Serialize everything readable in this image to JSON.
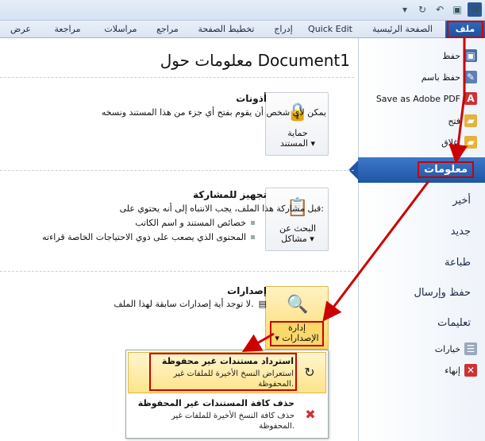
{
  "qat": {
    "word": "W"
  },
  "tabs": {
    "file": "ملف",
    "home": "الصفحة الرئيسية",
    "quickedit": "Quick Edit",
    "insert": "إدراج",
    "pagelayout": "تخطيط الصفحة",
    "references": "مراجع",
    "mailings": "مراسلات",
    "review": "مراجعة",
    "view": "عرض"
  },
  "left": {
    "save": "حفظ",
    "saveas": "حفظ باسم",
    "saveaspdf": "Save as Adobe PDF",
    "open": "فتح",
    "close": "إغلاق",
    "info": "معلومات",
    "recent": "أخير",
    "new": "جديد",
    "print": "طباعة",
    "savesend": "حفظ وإرسال",
    "help": "تعليمات",
    "options": "خيارات",
    "exit": "إنهاء"
  },
  "main": {
    "title": "معلومات حول Document1",
    "permissions": {
      "title": "أذونات",
      "desc": "يمكن لأي شخص أن يقوم بفتح أي جزء من هذا المستند ونسخه",
      "btn1": "حماية",
      "btn2": "المستند"
    },
    "share": {
      "title": "تجهيز للمشاركة",
      "desc": "قبل مشاركة هذا الملف، يجب الانتباه إلى أنه يحتوي على:",
      "b1": "خصائص المستند و اسم الكاتب",
      "b2": "المحتوى الذي يصعب على ذوي الاحتياجات الخاصة قراءته",
      "btn1": "البحث عن",
      "btn2": "مشاكل"
    },
    "versions": {
      "title": "إصدارات",
      "desc": "لا توجد أية إصدارات سابقة لهذا الملف.",
      "btn1": "إدارة",
      "btn2": "الإصدارات"
    }
  },
  "dropdown": {
    "item1_title": "استرداد مستندات غير محفوظة",
    "item1_desc": "استعراض النسخ الأخيرة للملفات غير المحفوظة.",
    "item2_title": "حذف كافة المستندات غير المحفوظة",
    "item2_desc": "حذف كافة النسخ الأخيرة للملفات غير المحفوظة."
  },
  "colors": {
    "accent": "#1f55a3",
    "highlight": "#cc0000"
  }
}
